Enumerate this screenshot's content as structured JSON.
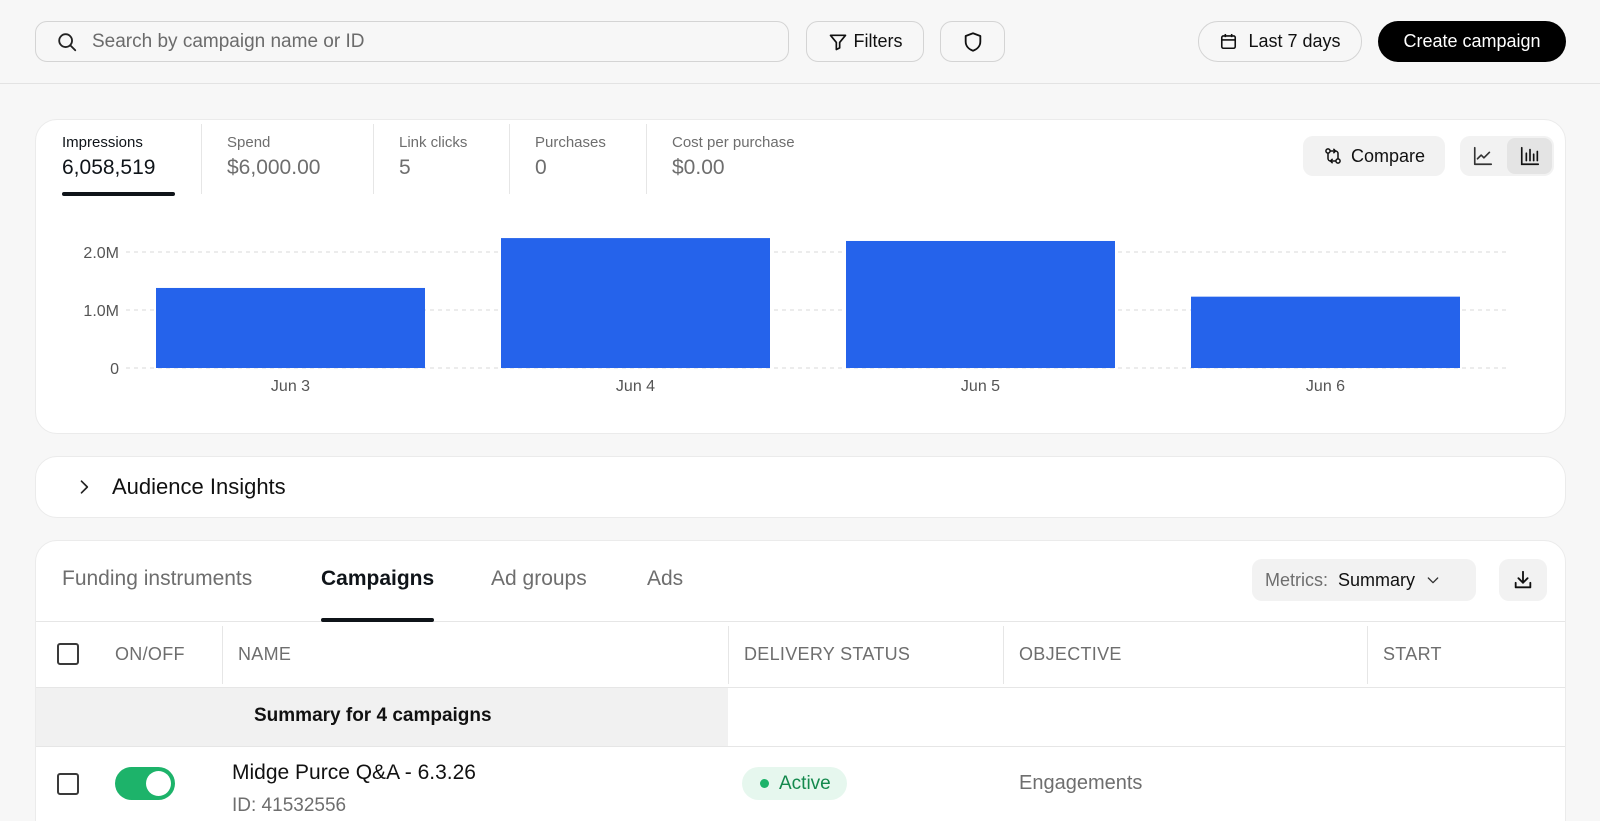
{
  "topbar": {
    "search_placeholder": "Search by campaign name or ID",
    "filters_label": "Filters",
    "date_range_label": "Last 7 days",
    "create_label": "Create campaign"
  },
  "metrics": [
    {
      "label": "Impressions",
      "value": "6,058,519",
      "active": true
    },
    {
      "label": "Spend",
      "value": "$6,000.00",
      "active": false
    },
    {
      "label": "Link clicks",
      "value": "5",
      "active": false
    },
    {
      "label": "Purchases",
      "value": "0",
      "active": false
    },
    {
      "label": "Cost per purchase",
      "value": "$0.00",
      "active": false
    }
  ],
  "compare_label": "Compare",
  "chart_data": {
    "type": "bar",
    "categories": [
      "Jun 3",
      "Jun 4",
      "Jun 5",
      "Jun 6"
    ],
    "values": [
      1380000,
      2240000,
      2190000,
      1230000
    ],
    "y_ticks": [
      0,
      1000000,
      2000000
    ],
    "y_tick_labels": [
      "0",
      "1.0M",
      "2.0M"
    ],
    "ylim": [
      0,
      2300000
    ],
    "grid": true,
    "bar_color": "#2563eb"
  },
  "insights": {
    "title": "Audience Insights"
  },
  "tabs": [
    {
      "label": "Funding instruments",
      "active": false
    },
    {
      "label": "Campaigns",
      "active": true
    },
    {
      "label": "Ad groups",
      "active": false
    },
    {
      "label": "Ads",
      "active": false
    }
  ],
  "metrics_select": {
    "label": "Metrics:",
    "value": "Summary"
  },
  "table": {
    "columns": [
      "ON/OFF",
      "NAME",
      "DELIVERY STATUS",
      "OBJECTIVE",
      "START"
    ],
    "summary": "Summary for 4 campaigns",
    "rows": [
      {
        "name": "Midge Purce Q&A - 6.3.26",
        "id": "ID: 41532556",
        "status": "Active",
        "objective": "Engagements",
        "enabled": true
      }
    ]
  },
  "colors": {
    "accent": "#2563eb",
    "active_green": "#1db36a",
    "primary_button": "#000000"
  }
}
